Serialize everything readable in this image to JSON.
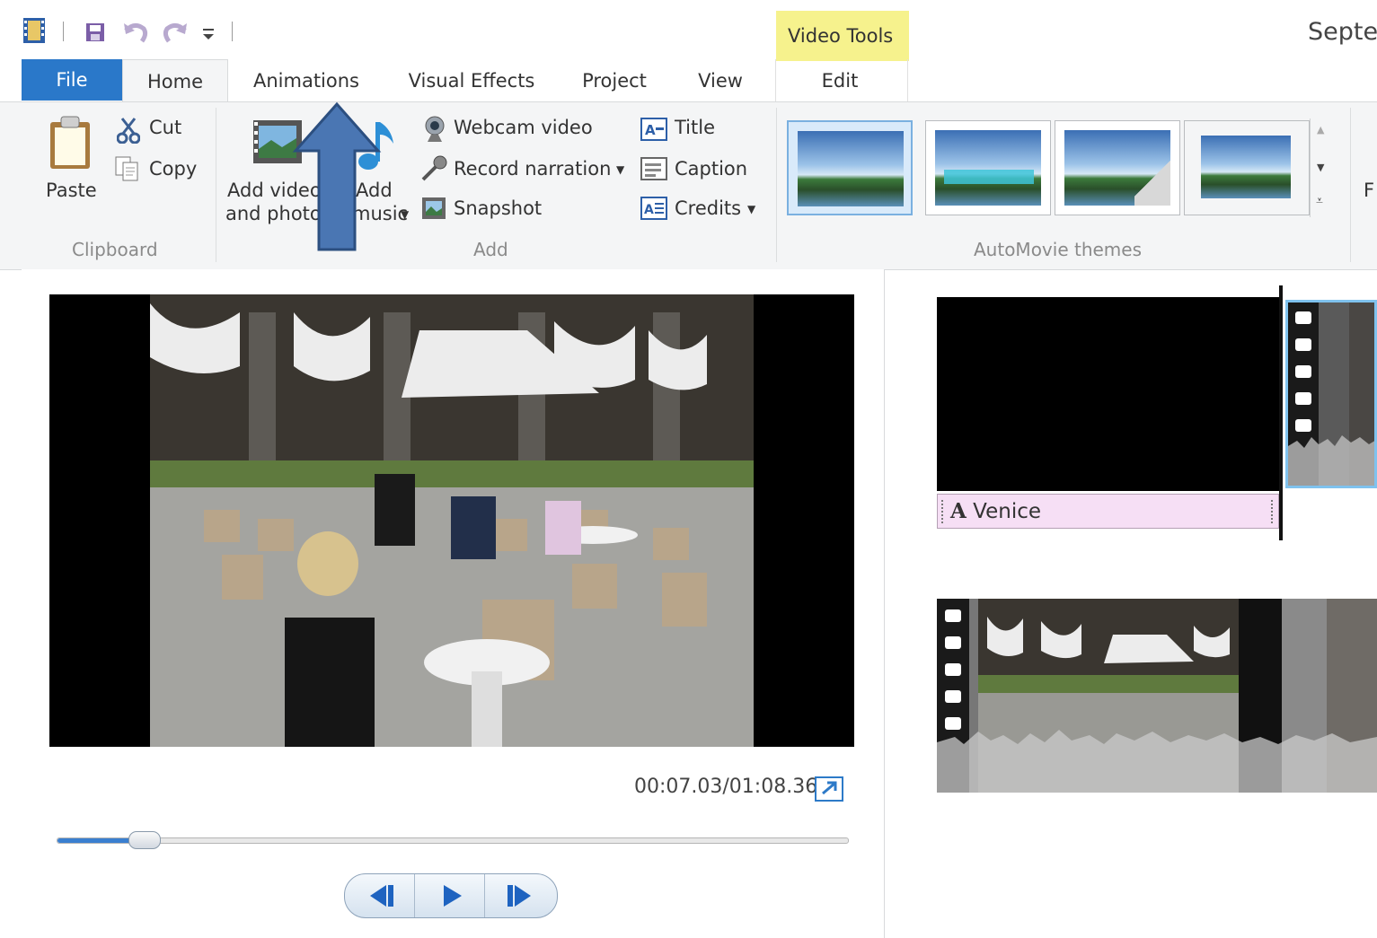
{
  "window": {
    "title_partial": "Septe",
    "contextual_tab_group": "Video Tools"
  },
  "tabs": [
    {
      "label": "File"
    },
    {
      "label": "Home"
    },
    {
      "label": "Animations"
    },
    {
      "label": "Visual Effects"
    },
    {
      "label": "Project"
    },
    {
      "label": "View"
    },
    {
      "label": "Edit"
    }
  ],
  "ribbon": {
    "clipboard": {
      "label": "Clipboard",
      "paste": "Paste",
      "cut": "Cut",
      "copy": "Copy"
    },
    "add": {
      "label": "Add",
      "add_videos_line1": "Add videos",
      "add_videos_line2": "and photos",
      "add_music_line1": "Add",
      "add_music_line2": "music",
      "webcam": "Webcam video",
      "narration": "Record narration",
      "snapshot": "Snapshot",
      "title": "Title",
      "caption": "Caption",
      "credits": "Credits"
    },
    "themes": {
      "label": "AutoMovie themes",
      "partial_next": "F"
    }
  },
  "preview": {
    "timecode": "00:07.03/01:08.36",
    "seek_position": 0.11
  },
  "storyboard": {
    "title_clip_caption": "Venice"
  },
  "colors": {
    "file_tab": "#2a78c9",
    "contextual_tab": "#f6f28d",
    "caption_bar": "#f6dff5",
    "annotation_arrow": "#4a76b3",
    "selected_clip_border": "#7fc2ee"
  },
  "icons": [
    "app-film-icon",
    "save-icon",
    "undo-icon",
    "redo-icon",
    "qat-dropdown-icon",
    "paste-icon",
    "cut-icon",
    "copy-icon",
    "add-videos-icon",
    "add-music-icon",
    "webcam-icon",
    "microphone-icon",
    "snapshot-icon",
    "title-icon",
    "caption-icon",
    "credits-icon",
    "fullscreen-icon",
    "previous-frame-icon",
    "play-icon",
    "next-frame-icon"
  ]
}
